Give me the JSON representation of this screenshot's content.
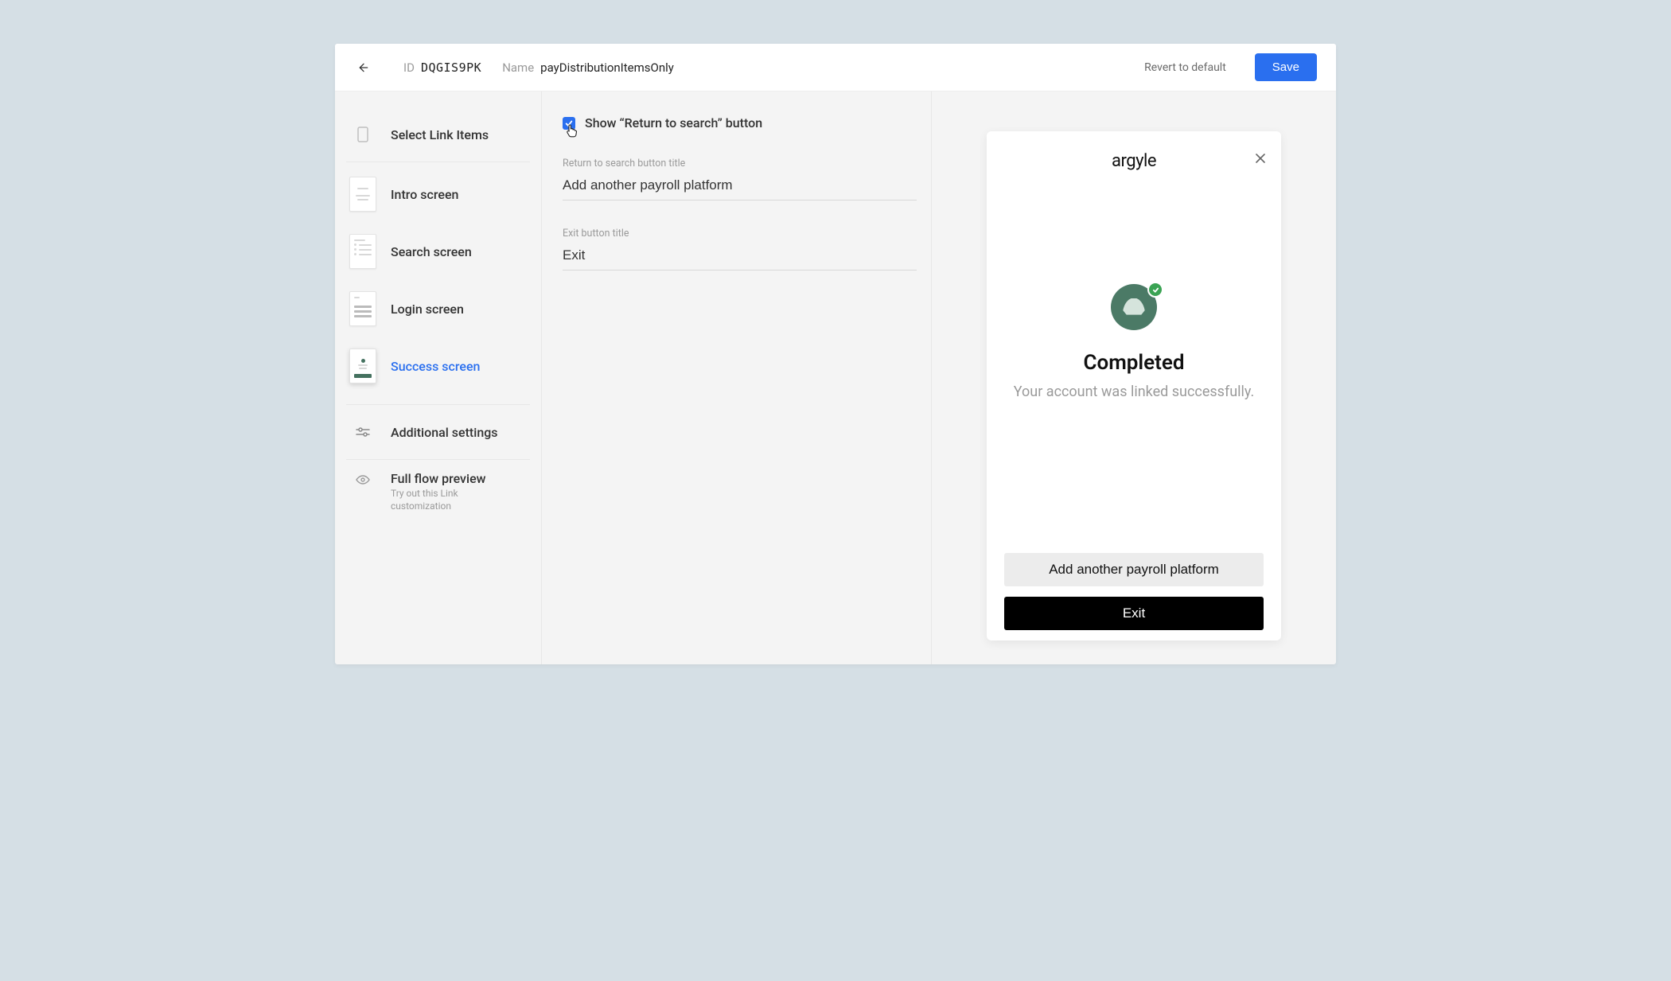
{
  "topbar": {
    "id_label": "ID",
    "id_value": "DQGIS9PK",
    "name_label": "Name",
    "name_value": "payDistributionItemsOnly",
    "revert_label": "Revert to default",
    "save_label": "Save"
  },
  "sidebar": {
    "select_link_label": "Select Link Items",
    "intro_label": "Intro screen",
    "search_label": "Search screen",
    "login_label": "Login screen",
    "success_label": "Success screen",
    "additional_label": "Additional settings",
    "preview_label": "Full flow preview",
    "preview_sub": "Try out this Link customization"
  },
  "form": {
    "show_return_label": "Show “Return to search” button",
    "return_title_label": "Return to search button title",
    "return_title_value": "Add another payroll platform",
    "exit_title_label": "Exit button title",
    "exit_title_value": "Exit"
  },
  "preview": {
    "brand": "argyle",
    "title": "Completed",
    "subtitle": "Your account was linked successfully.",
    "secondary_btn": "Add another payroll platform",
    "primary_btn": "Exit"
  }
}
